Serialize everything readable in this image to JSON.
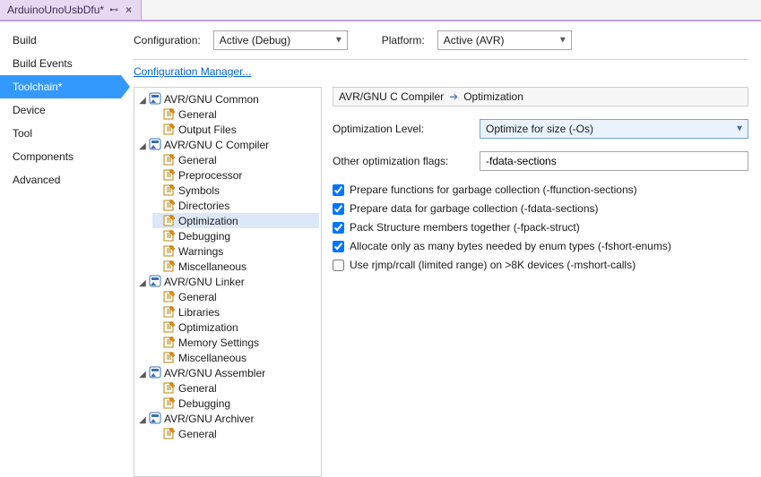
{
  "tab": {
    "title": "ArduinoUnoUsbDfu*"
  },
  "nav": {
    "items": [
      {
        "label": "Build"
      },
      {
        "label": "Build Events"
      },
      {
        "label": "Toolchain*"
      },
      {
        "label": "Device"
      },
      {
        "label": "Tool"
      },
      {
        "label": "Components"
      },
      {
        "label": "Advanced"
      }
    ],
    "activeIndex": 2
  },
  "top": {
    "configLabel": "Configuration:",
    "configValue": "Active (Debug)",
    "platformLabel": "Platform:",
    "platformValue": "Active (AVR)",
    "cfgMgr": "Configuration Manager..."
  },
  "tree": [
    {
      "label": "AVR/GNU Common",
      "children": [
        {
          "label": "General"
        },
        {
          "label": "Output Files"
        }
      ]
    },
    {
      "label": "AVR/GNU C Compiler",
      "children": [
        {
          "label": "General"
        },
        {
          "label": "Preprocessor"
        },
        {
          "label": "Symbols"
        },
        {
          "label": "Directories"
        },
        {
          "label": "Optimization",
          "selected": true
        },
        {
          "label": "Debugging"
        },
        {
          "label": "Warnings"
        },
        {
          "label": "Miscellaneous"
        }
      ]
    },
    {
      "label": "AVR/GNU Linker",
      "children": [
        {
          "label": "General"
        },
        {
          "label": "Libraries"
        },
        {
          "label": "Optimization"
        },
        {
          "label": "Memory Settings"
        },
        {
          "label": "Miscellaneous"
        }
      ]
    },
    {
      "label": "AVR/GNU Assembler",
      "children": [
        {
          "label": "General"
        },
        {
          "label": "Debugging"
        }
      ]
    },
    {
      "label": "AVR/GNU Archiver",
      "children": [
        {
          "label": "General"
        }
      ]
    }
  ],
  "breadcrumb": {
    "a": "AVR/GNU C Compiler",
    "b": "Optimization"
  },
  "form": {
    "optLevelLabel": "Optimization Level:",
    "optLevelValue": "Optimize for size (-Os)",
    "otherFlagsLabel": "Other optimization flags:",
    "otherFlagsValue": "-fdata-sections"
  },
  "checks": [
    {
      "label": "Prepare functions for garbage collection (-ffunction-sections)",
      "checked": true
    },
    {
      "label": "Prepare data for garbage collection (-fdata-sections)",
      "checked": true
    },
    {
      "label": "Pack Structure members together (-fpack-struct)",
      "checked": true
    },
    {
      "label": "Allocate only as many bytes needed by enum types (-fshort-enums)",
      "checked": true
    },
    {
      "label": "Use rjmp/rcall (limited range) on >8K devices (-mshort-calls)",
      "checked": false
    }
  ]
}
